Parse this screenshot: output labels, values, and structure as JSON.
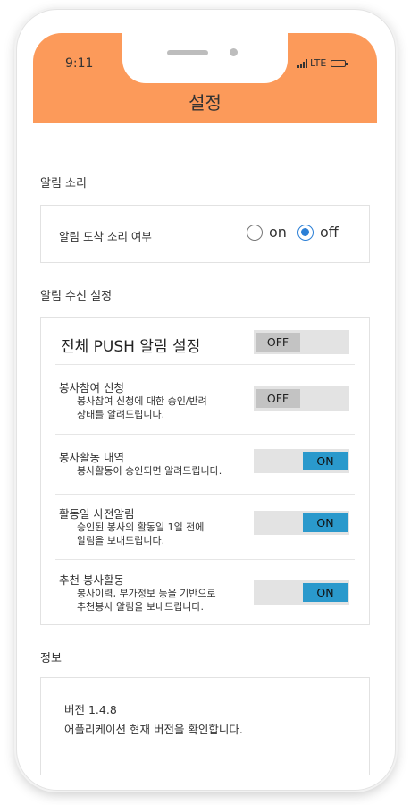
{
  "status_bar": {
    "time": "9:11",
    "network": "LTE"
  },
  "header": {
    "title": "설정"
  },
  "sound": {
    "section_label": "알림 소리",
    "row_label": "알림 도착 소리 여부",
    "options": [
      {
        "label": "on",
        "selected": false
      },
      {
        "label": "off",
        "selected": true
      }
    ]
  },
  "receive": {
    "section_label": "알림 수신 설정",
    "push_all": {
      "label": "전체 PUSH 알림 설정",
      "state": "OFF"
    },
    "items": [
      {
        "name": "봉사참여 신청",
        "desc_line1": "봉사참여 신청에 대한 승인/반려",
        "desc_line2": "상태를 알려드립니다.",
        "state": "OFF"
      },
      {
        "name": "봉사활동 내역",
        "desc_line1": "봉사활동이 승인되면 알려드립니다.",
        "desc_line2": "",
        "state": "ON"
      },
      {
        "name": "활동일 사전알림",
        "desc_line1": "승인된 봉사의 활동일 1일 전에",
        "desc_line2": "알림을 보내드립니다.",
        "state": "ON"
      },
      {
        "name": "추천 봉사활동",
        "desc_line1": "봉사이력, 부가정보 등을 기반으로",
        "desc_line2": "추천봉사 알림을 보내드립니다.",
        "state": "ON"
      }
    ]
  },
  "info": {
    "section_label": "정보",
    "version": "버전 1.4.8",
    "description": "어플리케이션 현재 버전을 확인합니다."
  },
  "colors": {
    "header": "#fc9a5a",
    "toggle_on": "#2a99cc",
    "toggle_off": "#c3c3c3",
    "radio_selected": "#2b7fd6"
  }
}
